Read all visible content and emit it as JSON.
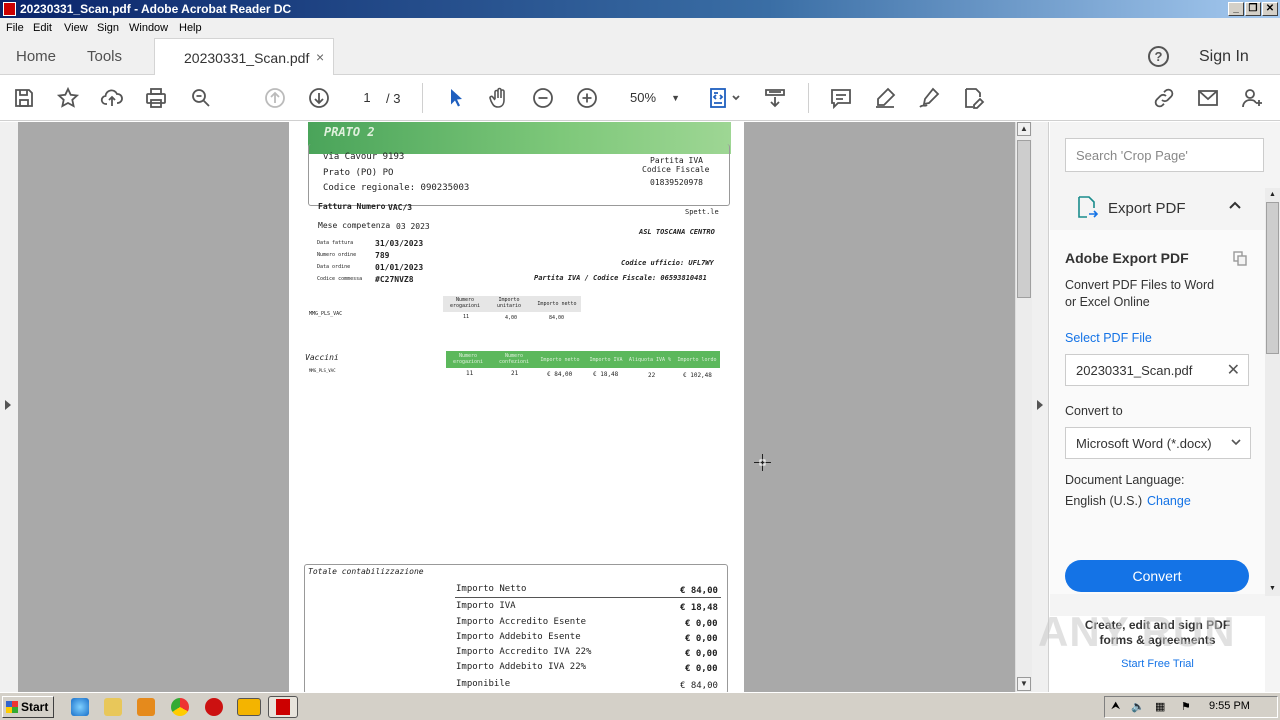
{
  "window": {
    "title": "20230331_Scan.pdf - Adobe Acrobat Reader DC"
  },
  "menu": [
    "File",
    "Edit",
    "View",
    "Sign",
    "Window",
    "Help"
  ],
  "tabs": {
    "home": "Home",
    "tools": "Tools",
    "document": "20230331_Scan.pdf",
    "close": "×",
    "signin": "Sign In",
    "help": "?"
  },
  "toolbar": {
    "page_current": "1",
    "page_total": "/ 3",
    "zoom": "50%",
    "icons": [
      "save-icon",
      "star-icon",
      "upload-icon",
      "print-icon",
      "zoom-search-icon",
      "prev-page-icon",
      "next-page-icon",
      "select-cursor-icon",
      "hand-icon",
      "zoom-out-icon",
      "zoom-in-icon",
      "fit-page-icon",
      "scroll-mode-icon",
      "comment-icon",
      "highlight-icon",
      "sign-icon",
      "edit-pdf-icon",
      "link-icon",
      "email-icon",
      "add-user-icon"
    ]
  },
  "document": {
    "banner": "PRATO 2",
    "address": [
      "via Cavour 9193",
      "Prato (PO) PO",
      "Codice regionale: 090235003"
    ],
    "vat_labels": [
      "Partita IVA",
      "Codice Fiscale",
      "01839520978"
    ],
    "invoice": {
      "numero_label": "Fattura Numero",
      "numero": "VAC/3",
      "mese_label": "Mese competenza",
      "mese": "03 2023",
      "fields": [
        {
          "label": "Data fattura",
          "value": "31/03/2023"
        },
        {
          "label": "Numero ordine",
          "value": "789"
        },
        {
          "label": "Data ordine",
          "value": "01/01/2023"
        },
        {
          "label": "Codice commessa",
          "value": "#C27NVZ8"
        }
      ]
    },
    "recipient": {
      "spett": "Spett.le",
      "name": "ASL TOSCANA CENTRO",
      "ufficio": "Codice ufficio: UFL7WY",
      "piva": "Partita IVA / Codice Fiscale: 06593810481"
    },
    "mini_table": {
      "headers": [
        "Numero erogazioni",
        "Importo unitario",
        "Importo netto"
      ],
      "row_label": "MMG_PLS_VAC",
      "row": [
        "11",
        "4,00",
        "84,00"
      ]
    },
    "vaccini": {
      "title": "Vaccini",
      "headers": [
        "Numero erogazioni",
        "Numero confezioni",
        "Importo netto",
        "Importo IVA",
        "Aliquota IVA %",
        "Importo lordo"
      ],
      "row_label": "MMG_PLS_VAC",
      "row": [
        "11",
        "21",
        "€ 84,00",
        "€ 18,48",
        "22",
        "€ 102,48"
      ]
    },
    "totale": {
      "title": "Totale contabilizzazione",
      "rows": [
        {
          "label": "Importo Netto",
          "value": "€ 84,00"
        },
        {
          "label": "Importo IVA",
          "value": "€ 18,48"
        },
        {
          "label": "Importo Accredito Esente",
          "value": "€ 0,00"
        },
        {
          "label": "Importo Addebito Esente",
          "value": "€ 0,00"
        },
        {
          "label": "Importo Accredito IVA 22%",
          "value": "€ 0,00"
        },
        {
          "label": "Importo Addebito IVA 22%",
          "value": "€ 0,00"
        },
        {
          "label": "Imponibile",
          "value": "€ 84,00"
        }
      ]
    }
  },
  "panel": {
    "search_placeholder": "Search 'Crop Page'",
    "export_label": "Export PDF",
    "heading": "Adobe Export PDF",
    "desc_line1": "Convert PDF Files to Word",
    "desc_line2": "or Excel Online",
    "select_file": "Select PDF File",
    "file_name": "20230331_Scan.pdf",
    "convert_to_label": "Convert to",
    "convert_to_value": "Microsoft Word (*.docx)",
    "doc_language_label": "Document Language:",
    "doc_language_value": "English (U.S.)",
    "change": "Change",
    "convert_button": "Convert",
    "promo_line1": "Create, edit and sign PDF",
    "promo_line2": "forms & agreements",
    "promo_link": "Start Free Trial"
  },
  "watermark": "ANY RUN",
  "taskbar": {
    "start": "Start",
    "clock": "9:55 PM"
  },
  "colors": {
    "accent": "#1473e6",
    "banner_green": "#5cb85c",
    "doc_bg": "#a9a9a9"
  }
}
